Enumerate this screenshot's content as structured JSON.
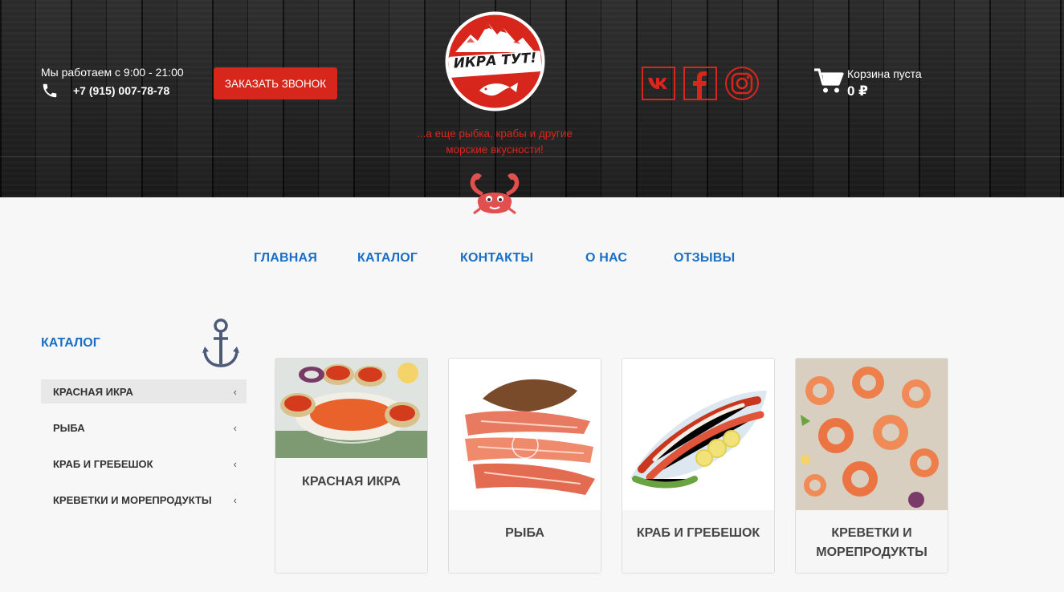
{
  "header": {
    "hours": "Мы работаем с 9:00 - 21:00",
    "phone": "+7 (915) 007-78-78",
    "call_button": "ЗАКАЗАТЬ ЗВОНОК",
    "logo_text": "ИКРА ТУТ!",
    "tagline": "...а еще рыбка, крабы и другие морские вкусности!",
    "cart_label": "Корзина пуста",
    "cart_total": "0 ₽",
    "social": [
      "vk-icon",
      "facebook-icon",
      "instagram-icon"
    ]
  },
  "nav": [
    "ГЛАВНАЯ",
    "КАТАЛОГ",
    "КОНТАКТЫ",
    "О НАС",
    "ОТЗЫВЫ"
  ],
  "sidebar": {
    "title": "КАТАЛОГ",
    "items": [
      {
        "label": "КРАСНАЯ ИКРА",
        "chevron": "‹"
      },
      {
        "label": "РЫБА",
        "chevron": "‹"
      },
      {
        "label": "КРАБ И ГРЕБЕШОК",
        "chevron": "‹"
      },
      {
        "label": "КРЕВЕТКИ И МОРЕПРОДУКТЫ",
        "chevron": "‹"
      }
    ]
  },
  "cards": [
    {
      "title": "КРАСНАЯ ИКРА"
    },
    {
      "title": "РЫБА"
    },
    {
      "title": "КРАБ И ГРЕБЕШОК"
    },
    {
      "title": "КРЕВЕТКИ И МОРЕПРОДУКТЫ"
    }
  ],
  "colors": {
    "brand_red": "#d7261b",
    "link_blue": "#1a6fc4",
    "header_dark": "#1c1c1c",
    "page_bg": "#f7f7f7"
  }
}
